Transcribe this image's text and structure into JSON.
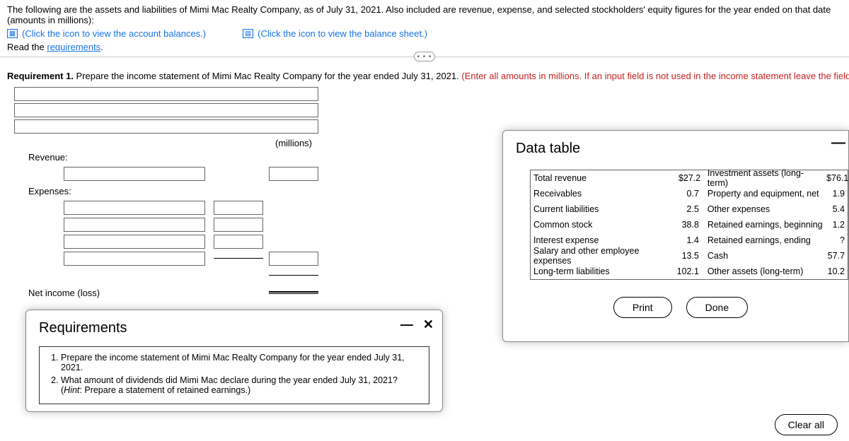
{
  "intro": "The following are the assets and liabilities of Mimi Mac Realty Company, as of July 31, 2021. Also included are revenue, expense, and selected stockholders' equity figures for the year ended on that date (amounts in millions):",
  "link1": "(Click the icon to view the account balances.)",
  "link2": "(Click the icon to view the balance sheet.)",
  "read_the": "Read the ",
  "requirements_word": "requirements",
  "period": ".",
  "req1_label": "Requirement 1.",
  "req1_text": " Prepare the income statement of Mimi Mac Realty Company for the year ended July 31, 2021. ",
  "req1_hint": "(Enter all amounts in millions. If an input field is not used in the income statement leave the field empty; do not select a labe",
  "millions_header": "(millions)",
  "revenue_label": "Revenue:",
  "expenses_label": "Expenses:",
  "netincome_label": "Net income (loss)",
  "req_popup": {
    "title": "Requirements",
    "item1": "Prepare the income statement of Mimi Mac Realty Company for the year ended July 31, 2021.",
    "item2_a": "What amount of dividends did Mimi Mac declare during the year ended July 31, 2021? (",
    "item2_hint_label": "Hint",
    "item2_b": ": Prepare a statement of retained earnings.)"
  },
  "data_popup": {
    "title": "Data table",
    "rows": [
      {
        "l": "Total revenue",
        "lv": "27.2",
        "r": "Investment assets (long-term)",
        "rv": "76.1",
        "d1": "$",
        "d2": "$"
      },
      {
        "l": "Receivables",
        "lv": "0.7",
        "r": "Property and equipment, net",
        "rv": "1.9"
      },
      {
        "l": "Current liabilities",
        "lv": "2.5",
        "r": "Other expenses",
        "rv": "5.4"
      },
      {
        "l": "Common stock",
        "lv": "38.8",
        "r": "Retained earnings, beginning",
        "rv": "1.2"
      },
      {
        "l": "Interest expense",
        "lv": "1.4",
        "r": "Retained earnings, ending",
        "rv": "?"
      },
      {
        "l": "Salary and other employee expenses",
        "lv": "13.5",
        "r": "Cash",
        "rv": "57.7"
      },
      {
        "l": "Long-term liabilities",
        "lv": "102.1",
        "r": "Other assets (long-term)",
        "rv": "10.2"
      }
    ],
    "print": "Print",
    "done": "Done"
  },
  "clear_all": "Clear all",
  "ellipsis": "• • •"
}
